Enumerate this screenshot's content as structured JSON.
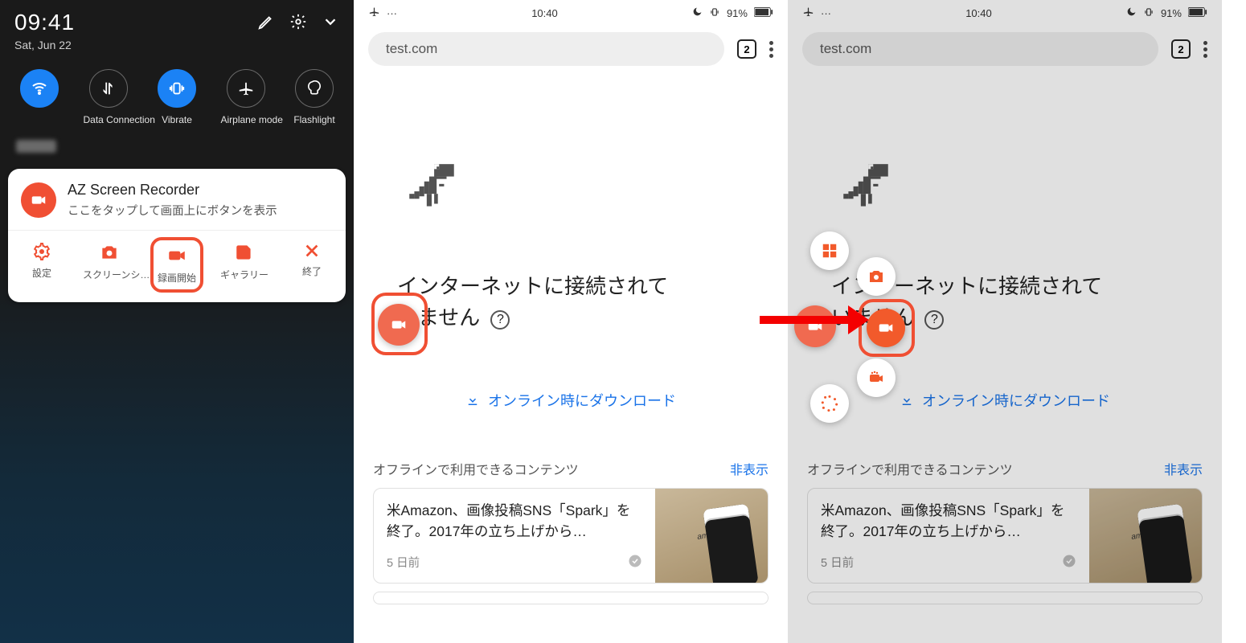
{
  "p1": {
    "time": "09:41",
    "date": "Sat, Jun 22",
    "tiles": [
      {
        "label": "",
        "on": true
      },
      {
        "label": "Data Connection",
        "on": false
      },
      {
        "label": "Vibrate",
        "on": true
      },
      {
        "label": "Airplane mode",
        "on": false
      },
      {
        "label": "Flashlight",
        "on": false
      }
    ],
    "notif": {
      "app": "AZ Screen Recorder",
      "msg": "ここをタップして画面上にボタンを表示",
      "actions": [
        "設定",
        "スクリーンシ…",
        "録画開始",
        "ギャラリー",
        "終了"
      ]
    }
  },
  "browser": {
    "status_time": "10:40",
    "battery": "91%",
    "url": "test.com",
    "tabs": "2",
    "error_l1": "インターネットに接続されて",
    "error_l2": "いません",
    "download": "オンライン時にダウンロード",
    "offline_heading": "オフラインで利用できるコンテンツ",
    "hide": "非表示",
    "article_title": "米Amazon、画像投稿SNS「Spark」を終了。2017年の立ち上げから…",
    "article_age": "5 日前",
    "thumb_label": "amazon"
  }
}
